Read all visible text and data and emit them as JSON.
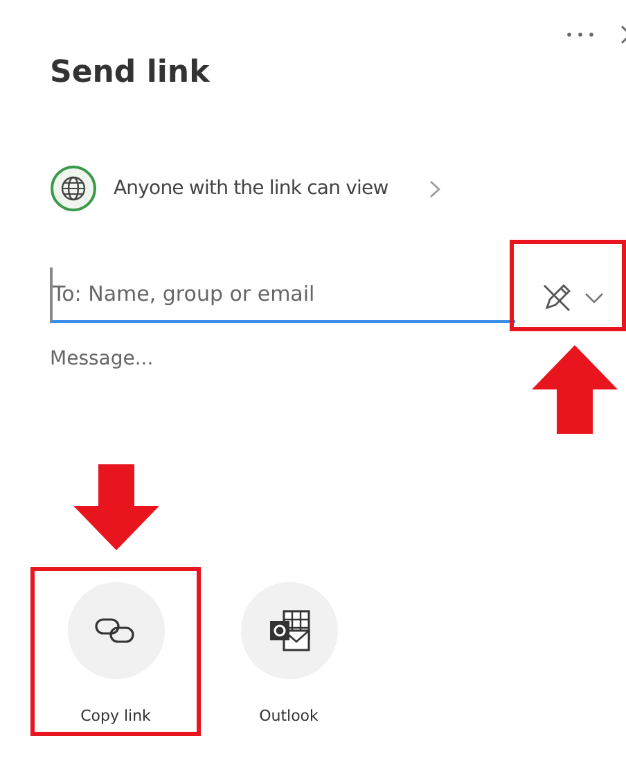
{
  "title": "Send link",
  "permission": {
    "label": "Anyone with the link can view"
  },
  "recipient": {
    "placeholder": "To: Name, group or email",
    "focused": true
  },
  "edit_control": {
    "highlighted": true,
    "arrow_marked": true
  },
  "message": {
    "placeholder": "Message..."
  },
  "share_targets": [
    {
      "kind": "link",
      "label": "Copy link",
      "highlighted": true,
      "arrow_marked": true
    },
    {
      "kind": "outlook",
      "label": "Outlook",
      "highlighted": false,
      "arrow_marked": false
    }
  ]
}
